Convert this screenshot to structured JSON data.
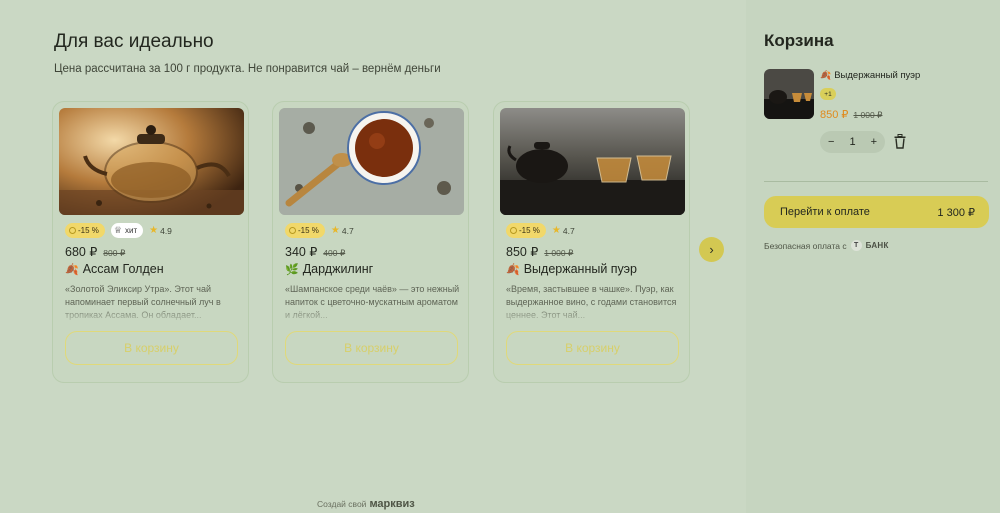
{
  "main": {
    "title": "Для вас идеально",
    "subtitle": "Цена рассчитана за 100 г продукта. Не понравится чай – вернём деньги"
  },
  "products": [
    {
      "discount": "-15 %",
      "hit": "хит",
      "rating": "4.9",
      "price": "680 ₽",
      "old_price": "800 ₽",
      "name": "Ассам Голден",
      "description": "«Золотой Эликсир Утра». Этот чай напоминает первый солнечный луч в тропиках Ассама. Он обладает...",
      "button": "В корзину",
      "icon": "leaf-icon"
    },
    {
      "discount": "-15 %",
      "rating": "4.7",
      "price": "340 ₽",
      "old_price": "400 ₽",
      "name": "Дарджилинг",
      "description": "«Шампанское среди чаёв» — это нежный напиток с цветочно-мускатным ароматом и лёгкой...",
      "button": "В корзину",
      "icon": "herb-icon"
    },
    {
      "discount": "-15 %",
      "rating": "4.7",
      "price": "850 ₽",
      "old_price": "1 000 ₽",
      "name": "Выдержанный пуэр",
      "description": "«Время, застывшее в чашке». Пуэр, как выдержанное вино, с годами становится ценнее. Этот чай...",
      "button": "В корзину",
      "icon": "leaf-icon"
    }
  ],
  "next_icon": "chevron-right-icon",
  "footer": {
    "text": "Создай свой",
    "brand": "марквиз"
  },
  "cart": {
    "title": "Корзина",
    "item": {
      "name": "Выдержанный пуэр",
      "badge": "+1",
      "price": "850 ₽",
      "old_price": "1 000 ₽",
      "quantity": "1",
      "minus": "−",
      "plus": "+"
    },
    "pay_label": "Перейти к оплате",
    "total": "1 300 ₽",
    "secure_text": "Безопасная оплата с",
    "bank_letter": "Т",
    "bank_label": "БАНК"
  },
  "colors": {
    "background": "#cad8c4",
    "accent": "#d8cc55",
    "discount": "#f1d86a",
    "cart_price": "#e08a1c"
  }
}
